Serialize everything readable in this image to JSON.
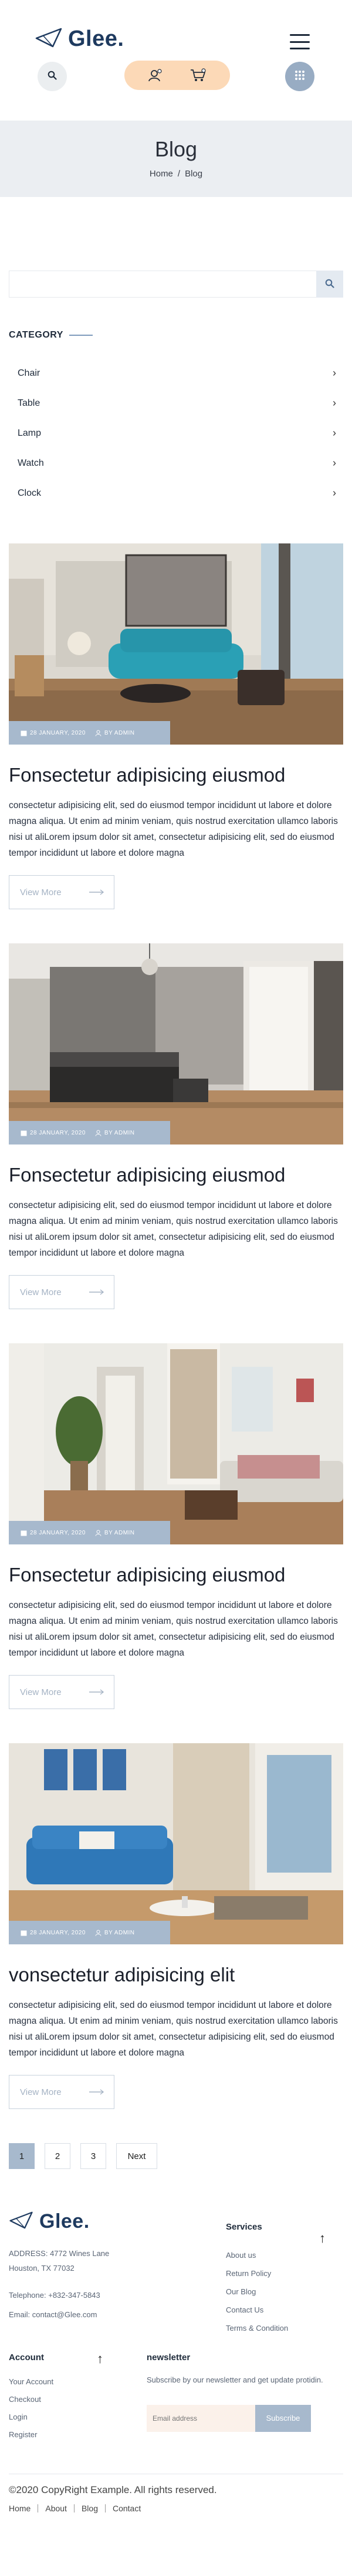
{
  "brand": {
    "name": "Glee."
  },
  "banner": {
    "title": "Blog",
    "crumb_home": "Home",
    "crumb_sep": "/",
    "crumb_current": "Blog"
  },
  "search": {
    "placeholder": ""
  },
  "category": {
    "title": "CATEGORY",
    "items": [
      {
        "label": "Chair"
      },
      {
        "label": "Table"
      },
      {
        "label": "Lamp"
      },
      {
        "label": "Watch"
      },
      {
        "label": "Clock"
      }
    ]
  },
  "posts": [
    {
      "date": "28 JANUARY, 2020",
      "author": "BY ADMIN",
      "title": "Fonsectetur adipisicing eiusmod",
      "excerpt": "consectetur adipisicing elit, sed do eiusmod tempor incididunt ut labore et dolore magna aliqua. Ut enim ad minim veniam, quis nostrud exercitation ullamco laboris nisi ut aliLorem ipsum dolor sit amet, consectetur adipisicing elit, sed do eiusmod tempor incididunt ut labore et dolore magna",
      "button": "View More"
    },
    {
      "date": "28 JANUARY, 2020",
      "author": "BY ADMIN",
      "title": "Fonsectetur adipisicing eiusmod",
      "excerpt": "consectetur adipisicing elit, sed do eiusmod tempor incididunt ut labore et dolore magna aliqua. Ut enim ad minim veniam, quis nostrud exercitation ullamco laboris nisi ut aliLorem ipsum dolor sit amet, consectetur adipisicing elit, sed do eiusmod tempor incididunt ut labore et dolore magna",
      "button": "View More"
    },
    {
      "date": "28 JANUARY, 2020",
      "author": "BY ADMIN",
      "title": "Fonsectetur adipisicing eiusmod",
      "excerpt": "consectetur adipisicing elit, sed do eiusmod tempor incididunt ut labore et dolore magna aliqua. Ut enim ad minim veniam, quis nostrud exercitation ullamco laboris nisi ut aliLorem ipsum dolor sit amet, consectetur adipisicing elit, sed do eiusmod tempor incididunt ut labore et dolore magna",
      "button": "View More"
    },
    {
      "date": "28 JANUARY, 2020",
      "author": "BY ADMIN",
      "title": "vonsectetur adipisicing elit",
      "excerpt": "consectetur adipisicing elit, sed do eiusmod tempor incididunt ut labore et dolore magna aliqua. Ut enim ad minim veniam, quis nostrud exercitation ullamco laboris nisi ut aliLorem ipsum dolor sit amet, consectetur adipisicing elit, sed do eiusmod tempor incididunt ut labore et dolore magna",
      "button": "View More"
    }
  ],
  "pagination": {
    "pages": [
      "1",
      "2",
      "3"
    ],
    "next": "Next",
    "active": "1"
  },
  "footer": {
    "address": "ADDRESS: 4772 Wines Lane Houston, TX 77032",
    "phone": "Telephone: +832-347-5843",
    "email": "Email: contact@Glee.com",
    "services_title": "Services",
    "services": [
      "About us",
      "Return Policy",
      "Our Blog",
      "Contact Us",
      "Terms & Condition"
    ],
    "account_title": "Account",
    "account": [
      "Your Account",
      "Checkout",
      "Login",
      "Register"
    ],
    "newsletter_title": "newsletter",
    "newsletter_text": "Subscribe by our newsletter and get update protidin.",
    "newsletter_placeholder": "Email address",
    "newsletter_button": "Subscribe",
    "copyright": "©2020 CopyRight Example. All rights reserved.",
    "nav": [
      "Home",
      "About",
      "Blog",
      "Contact"
    ]
  },
  "colors": {
    "brand": "#1e3a5f",
    "accent": "#a7b9cd",
    "peach": "#fcd9b7",
    "banner_bg": "#ebeef2"
  }
}
